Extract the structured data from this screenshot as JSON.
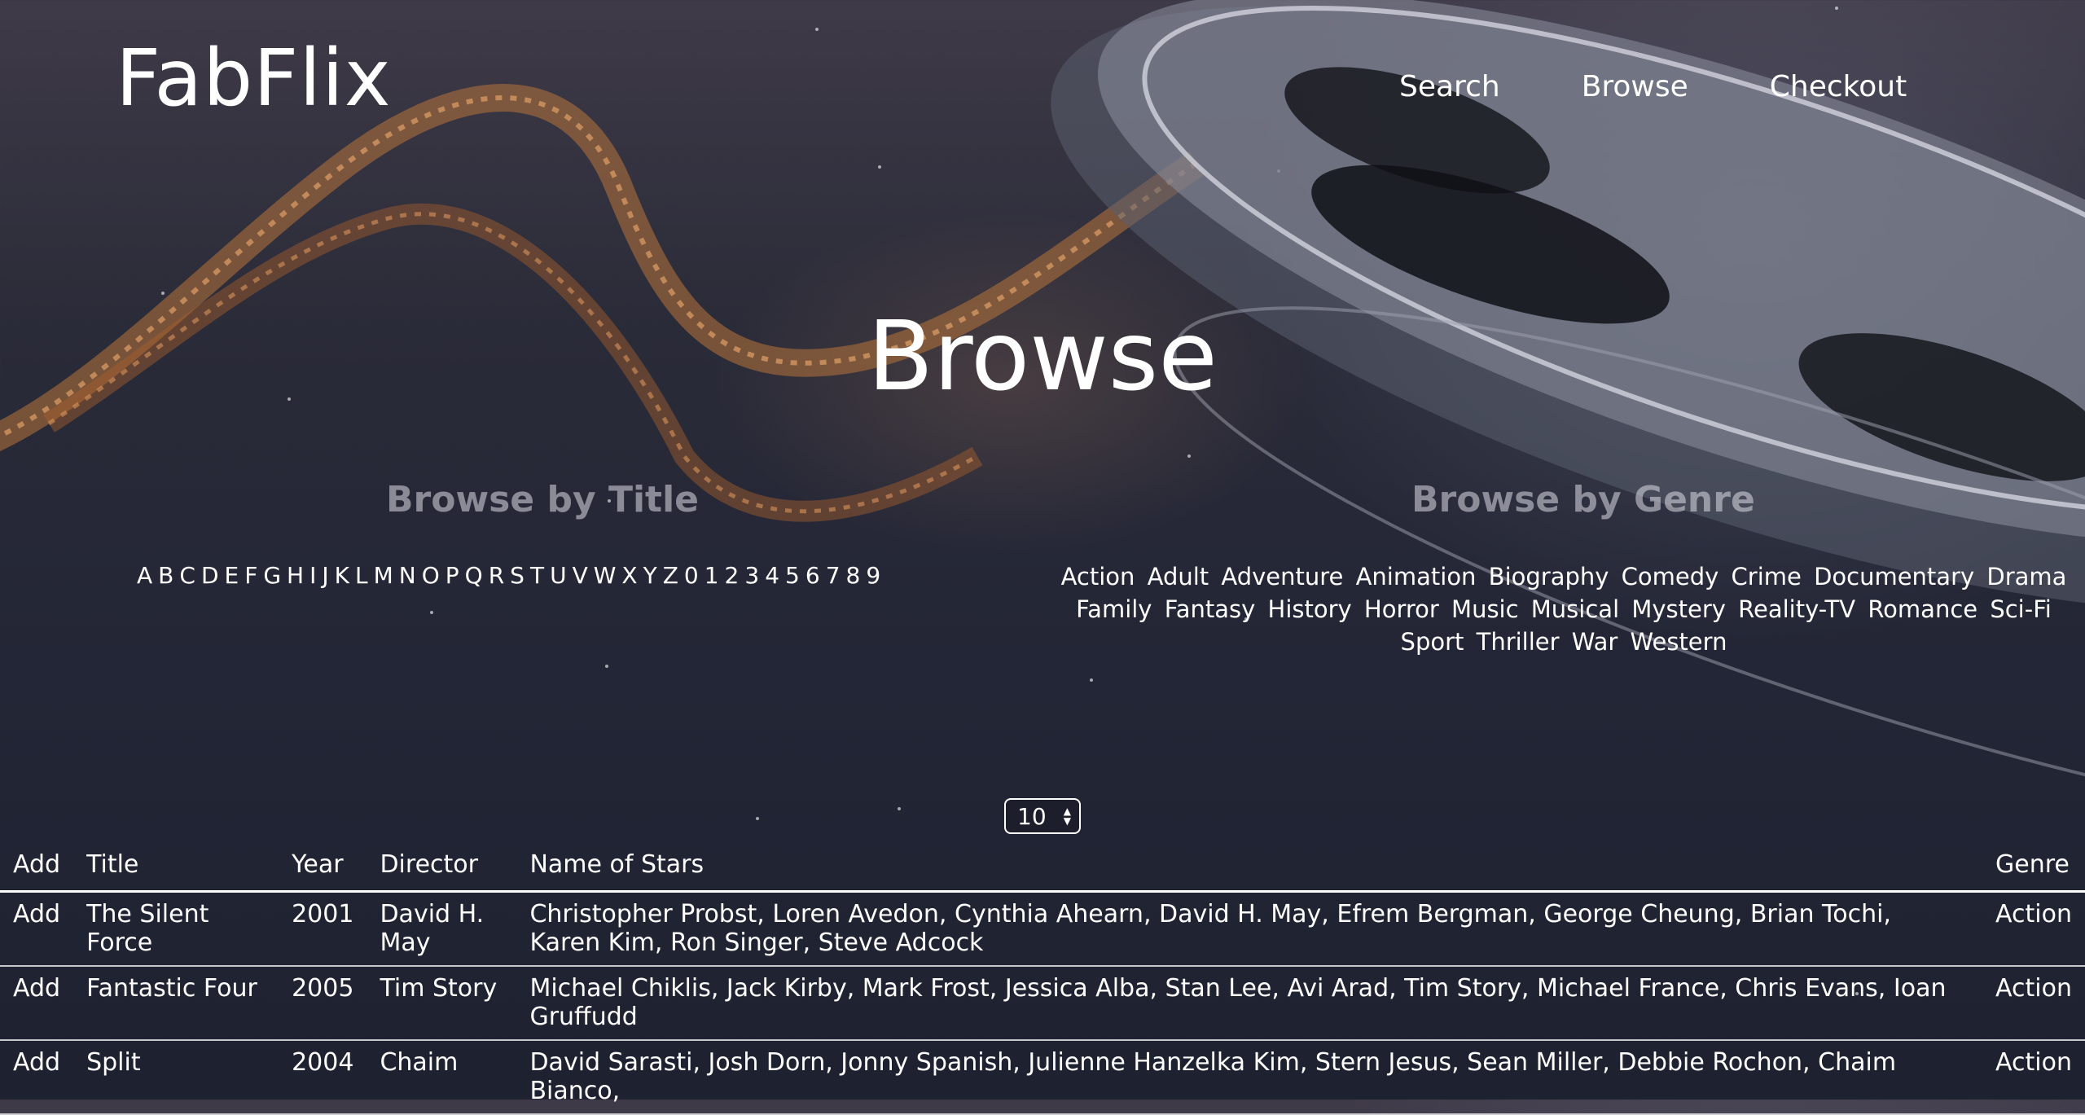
{
  "header": {
    "logo": "FabFlix",
    "nav": [
      "Search",
      "Browse",
      "Checkout"
    ]
  },
  "page": {
    "title": "Browse",
    "browse_by_title_heading": "Browse by Title",
    "browse_by_genre_heading": "Browse by Genre"
  },
  "title_letters": [
    "A",
    "B",
    "C",
    "D",
    "E",
    "F",
    "G",
    "H",
    "I",
    "J",
    "K",
    "L",
    "M",
    "N",
    "O",
    "P",
    "Q",
    "R",
    "S",
    "T",
    "U",
    "V",
    "W",
    "X",
    "Y",
    "Z",
    "0",
    "1",
    "2",
    "3",
    "4",
    "5",
    "6",
    "7",
    "8",
    "9"
  ],
  "genres": [
    "Action",
    "Adult",
    "Adventure",
    "Animation",
    "Biography",
    "Comedy",
    "Crime",
    "Documentary",
    "Drama",
    "Family",
    "Fantasy",
    "History",
    "Horror",
    "Music",
    "Musical",
    "Mystery",
    "Reality-TV",
    "Romance",
    "Sci-Fi",
    "Sport",
    "Thriller",
    "War",
    "Western"
  ],
  "page_size": {
    "value": "10"
  },
  "table": {
    "headers": [
      "Add",
      "Title",
      "Year",
      "Director",
      "Name of Stars",
      "Genre"
    ],
    "rows": [
      {
        "add": "Add",
        "title": "The Silent Force",
        "year": "2001",
        "director": "David H. May",
        "stars": "Christopher Probst, Loren Avedon, Cynthia Ahearn, David H. May, Efrem Bergman, George Cheung, Brian Tochi, Karen Kim, Ron Singer, Steve Adcock",
        "genre": "Action"
      },
      {
        "add": "Add",
        "title": "Fantastic Four",
        "year": "2005",
        "director": "Tim Story",
        "stars": "Michael Chiklis, Jack Kirby, Mark Frost, Jessica Alba, Stan Lee, Avi Arad, Tim Story, Michael France, Chris Evans, Ioan Gruffudd",
        "genre": "Action"
      },
      {
        "add": "Add",
        "title": "Split",
        "year": "2004",
        "director": "Chaim",
        "stars": "David Sarasti, Josh Dorn, Jonny Spanish, Julienne Hanzelka Kim, Stern Jesus, Sean Miller, Debbie Rochon, Chaim Bianco,",
        "genre": "Action"
      }
    ]
  }
}
